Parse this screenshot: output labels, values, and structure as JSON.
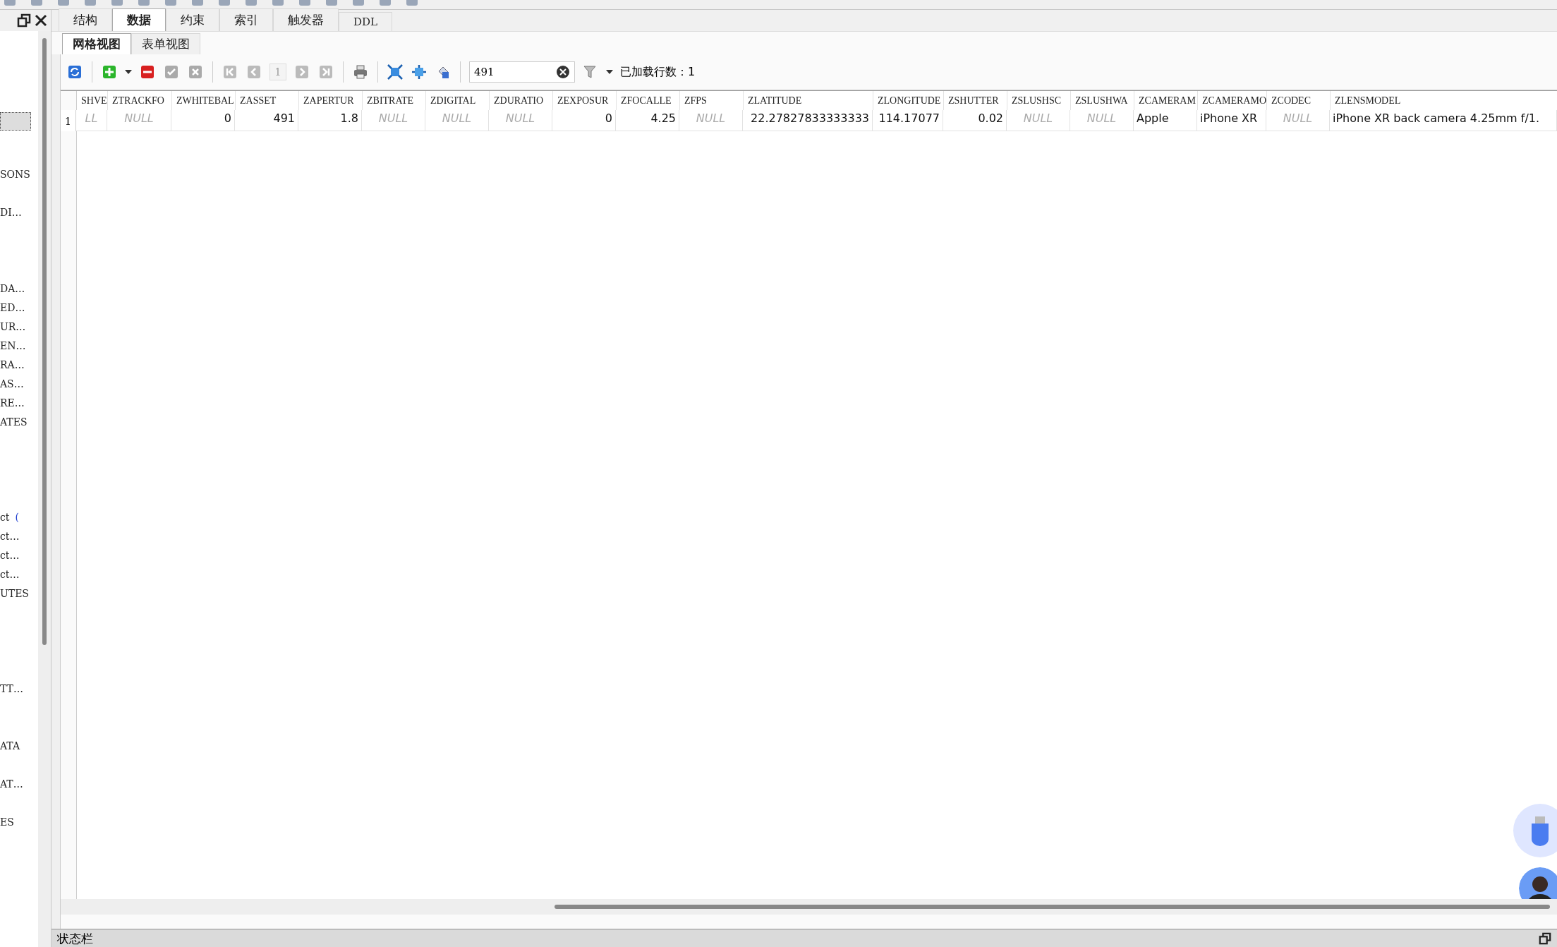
{
  "sidebar": {
    "items": [
      {
        "label": "SONS"
      },
      {
        "label": "DI…"
      },
      {
        "label": "DA…"
      },
      {
        "label": "ED…"
      },
      {
        "label": "UR…"
      },
      {
        "label": "EN…"
      },
      {
        "label": "RA…"
      },
      {
        "label": "AS…"
      },
      {
        "label": "RE…"
      },
      {
        "label": "ATES"
      },
      {
        "label": "ct",
        "suffix": "("
      },
      {
        "label": "ct…"
      },
      {
        "label": "ct…"
      },
      {
        "label": "ct…"
      },
      {
        "label": "UTES"
      },
      {
        "label": "TT…"
      },
      {
        "label": "ATA"
      },
      {
        "label": "AT…"
      },
      {
        "label": "ES"
      }
    ]
  },
  "tabs": [
    {
      "label": "结构",
      "selected": false
    },
    {
      "label": "数据",
      "selected": true
    },
    {
      "label": "约束",
      "selected": false
    },
    {
      "label": "索引",
      "selected": false
    },
    {
      "label": "触发器",
      "selected": false
    },
    {
      "label": "DDL",
      "selected": false
    }
  ],
  "view_tabs": [
    {
      "label": "网格视图",
      "selected": true
    },
    {
      "label": "表单视图",
      "selected": false
    }
  ],
  "toolbar": {
    "page": "1",
    "search": "491",
    "rows_loaded": "已加载行数：1"
  },
  "table": {
    "columns": [
      "SHVE",
      "ZTRACKFO",
      "ZWHITEBAL",
      "ZASSET",
      "ZAPERTUR",
      "ZBITRATE",
      "ZDIGITAL",
      "ZDURATIO",
      "ZEXPOSUR",
      "ZFOCALLE",
      "ZFPS",
      "ZLATITUDE",
      "ZLONGITUDE",
      "ZSHUTTER",
      "ZSLUSHSC",
      "ZSLUSHWA",
      "ZCAMERAM",
      "ZCAMERAMO",
      "ZCODEC",
      "ZLENSMODEL"
    ],
    "rows": [
      {
        "number": "1",
        "cells": [
          {
            "kind": "null",
            "text": "LL"
          },
          {
            "kind": "null",
            "text": "NULL"
          },
          {
            "kind": "number",
            "text": "0"
          },
          {
            "kind": "number",
            "text": "491"
          },
          {
            "kind": "number",
            "text": "1.8"
          },
          {
            "kind": "null",
            "text": "NULL"
          },
          {
            "kind": "null",
            "text": "NULL"
          },
          {
            "kind": "null",
            "text": "NULL"
          },
          {
            "kind": "number",
            "text": "0"
          },
          {
            "kind": "number",
            "text": "4.25"
          },
          {
            "kind": "null",
            "text": "NULL"
          },
          {
            "kind": "number",
            "text": "22.27827833333333"
          },
          {
            "kind": "number",
            "text": "114.17077"
          },
          {
            "kind": "number",
            "text": "0.02"
          },
          {
            "kind": "null",
            "text": "NULL"
          },
          {
            "kind": "null",
            "text": "NULL"
          },
          {
            "kind": "text",
            "text": "Apple"
          },
          {
            "kind": "text",
            "text": "iPhone XR"
          },
          {
            "kind": "null",
            "text": "NULL"
          },
          {
            "kind": "text",
            "text": "iPhone XR back camera 4.25mm f/1."
          }
        ]
      }
    ]
  },
  "status_bar": {
    "title": "状态栏"
  }
}
